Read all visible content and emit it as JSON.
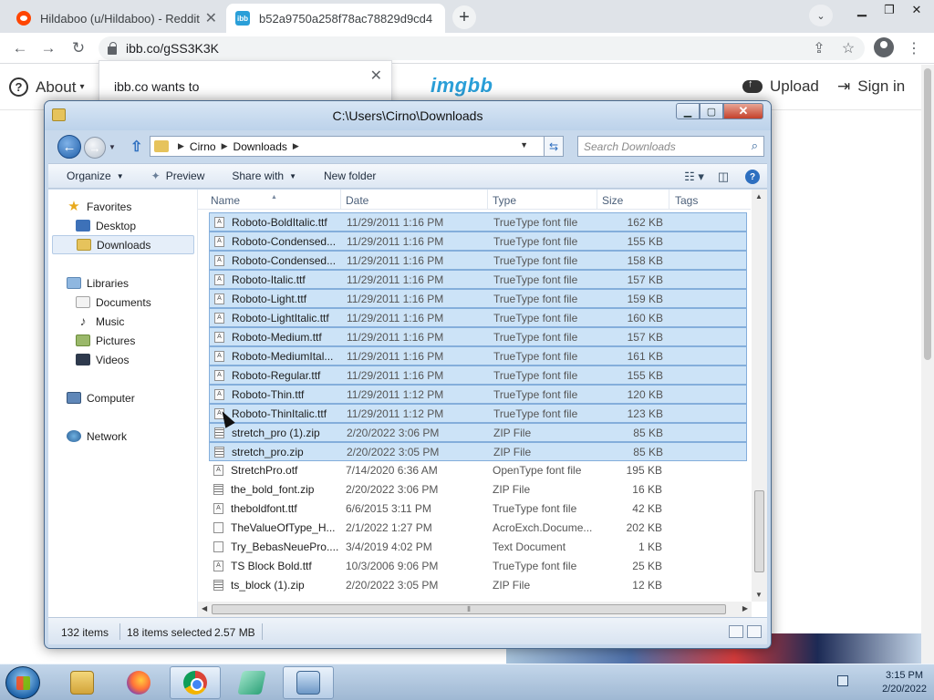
{
  "browser": {
    "tabs": [
      {
        "title": "Hildaboo (u/Hildaboo) - Reddit",
        "favicon": "reddit-icon"
      },
      {
        "title": "b52a9750a258f78ac78829d9cd4",
        "favicon": "imgbb-icon",
        "favicon_text": "ibb"
      }
    ],
    "url": "ibb.co/gSS3K3K",
    "permission_prompt": "ibb.co wants to"
  },
  "site": {
    "about_label": "About",
    "logo": "imgbb",
    "upload_label": "Upload",
    "signin_label": "Sign in"
  },
  "explorer": {
    "title": "C:\\Users\\Cirno\\Downloads",
    "breadcrumb": [
      "Cirno",
      "Downloads"
    ],
    "search_placeholder": "Search Downloads",
    "commands": {
      "organize": "Organize",
      "preview": "Preview",
      "share_with": "Share with",
      "new_folder": "New folder"
    },
    "nav": {
      "favorites": "Favorites",
      "desktop": "Desktop",
      "downloads": "Downloads",
      "libraries": "Libraries",
      "documents": "Documents",
      "music": "Music",
      "pictures": "Pictures",
      "videos": "Videos",
      "computer": "Computer",
      "network": "Network"
    },
    "columns": {
      "name": "Name",
      "date": "Date",
      "type": "Type",
      "size": "Size",
      "tags": "Tags"
    },
    "files": [
      {
        "name": "Roboto-BoldItalic.ttf",
        "date": "11/29/2011 1:16 PM",
        "type": "TrueType font file",
        "size": "162 KB",
        "selected": true,
        "kind": "font"
      },
      {
        "name": "Roboto-Condensed...",
        "date": "11/29/2011 1:16 PM",
        "type": "TrueType font file",
        "size": "155 KB",
        "selected": true,
        "kind": "font"
      },
      {
        "name": "Roboto-Condensed...",
        "date": "11/29/2011 1:16 PM",
        "type": "TrueType font file",
        "size": "158 KB",
        "selected": true,
        "kind": "font"
      },
      {
        "name": "Roboto-Italic.ttf",
        "date": "11/29/2011 1:16 PM",
        "type": "TrueType font file",
        "size": "157 KB",
        "selected": true,
        "kind": "font"
      },
      {
        "name": "Roboto-Light.ttf",
        "date": "11/29/2011 1:16 PM",
        "type": "TrueType font file",
        "size": "159 KB",
        "selected": true,
        "kind": "font"
      },
      {
        "name": "Roboto-LightItalic.ttf",
        "date": "11/29/2011 1:16 PM",
        "type": "TrueType font file",
        "size": "160 KB",
        "selected": true,
        "kind": "font"
      },
      {
        "name": "Roboto-Medium.ttf",
        "date": "11/29/2011 1:16 PM",
        "type": "TrueType font file",
        "size": "157 KB",
        "selected": true,
        "kind": "font"
      },
      {
        "name": "Roboto-MediumItal...",
        "date": "11/29/2011 1:16 PM",
        "type": "TrueType font file",
        "size": "161 KB",
        "selected": true,
        "kind": "font"
      },
      {
        "name": "Roboto-Regular.ttf",
        "date": "11/29/2011 1:16 PM",
        "type": "TrueType font file",
        "size": "155 KB",
        "selected": true,
        "kind": "font"
      },
      {
        "name": "Roboto-Thin.ttf",
        "date": "11/29/2011 1:12 PM",
        "type": "TrueType font file",
        "size": "120 KB",
        "selected": true,
        "kind": "font"
      },
      {
        "name": "Roboto-ThinItalic.ttf",
        "date": "11/29/2011 1:12 PM",
        "type": "TrueType font file",
        "size": "123 KB",
        "selected": true,
        "kind": "font"
      },
      {
        "name": "stretch_pro (1).zip",
        "date": "2/20/2022 3:06 PM",
        "type": "ZIP File",
        "size": "85 KB",
        "selected": true,
        "kind": "zip"
      },
      {
        "name": "stretch_pro.zip",
        "date": "2/20/2022 3:05 PM",
        "type": "ZIP File",
        "size": "85 KB",
        "selected": true,
        "kind": "zip"
      },
      {
        "name": "StretchPro.otf",
        "date": "7/14/2020 6:36 AM",
        "type": "OpenType font file",
        "size": "195 KB",
        "selected": false,
        "kind": "font"
      },
      {
        "name": "the_bold_font.zip",
        "date": "2/20/2022 3:06 PM",
        "type": "ZIP File",
        "size": "16 KB",
        "selected": false,
        "kind": "zip"
      },
      {
        "name": "theboldfont.ttf",
        "date": "6/6/2015 3:11 PM",
        "type": "TrueType font file",
        "size": "42 KB",
        "selected": false,
        "kind": "font"
      },
      {
        "name": "TheValueOfType_H...",
        "date": "2/1/2022 1:27 PM",
        "type": "AcroExch.Docume...",
        "size": "202 KB",
        "selected": false,
        "kind": "doc"
      },
      {
        "name": "Try_BebasNeuePro....",
        "date": "3/4/2019 4:02 PM",
        "type": "Text Document",
        "size": "1 KB",
        "selected": false,
        "kind": "doc"
      },
      {
        "name": "TS Block Bold.ttf",
        "date": "10/3/2006 9:06 PM",
        "type": "TrueType font file",
        "size": "25 KB",
        "selected": false,
        "kind": "font"
      },
      {
        "name": "ts_block (1).zip",
        "date": "2/20/2022 3:05 PM",
        "type": "ZIP File",
        "size": "12 KB",
        "selected": false,
        "kind": "zip"
      }
    ],
    "status": {
      "item_count": "132 items",
      "selected_count": "18 items selected",
      "selected_size": "2.57 MB"
    }
  },
  "taskbar": {
    "time": "3:15 PM",
    "date": "2/20/2022"
  }
}
